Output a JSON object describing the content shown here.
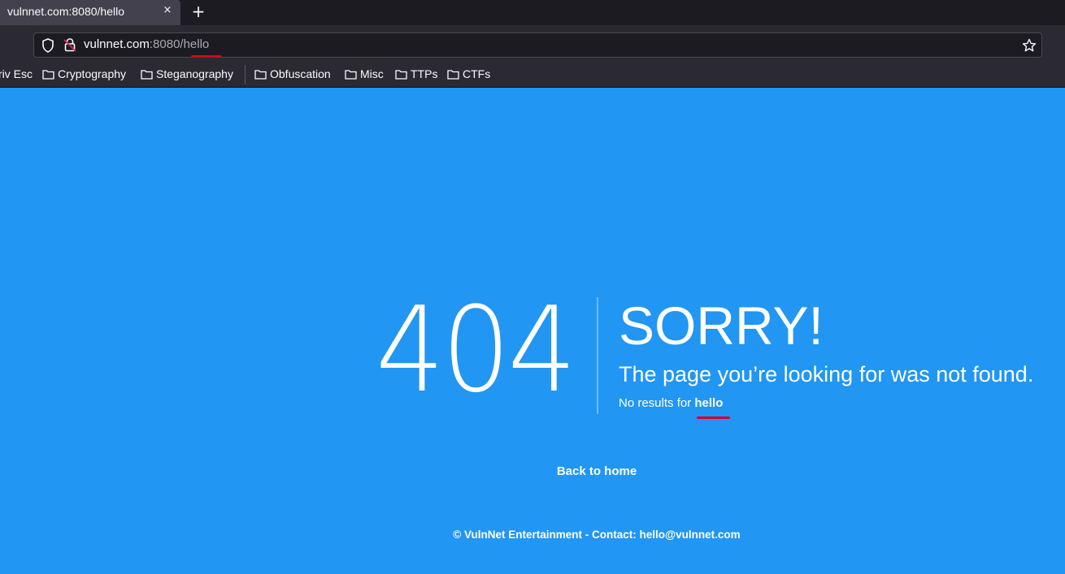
{
  "browser": {
    "tab": {
      "title": "vulnnet.com:8080/hello",
      "close_glyph": "×"
    },
    "new_tab_glyph": "+",
    "url": {
      "host": "vulnnet.com",
      "rest": ":8080/hello"
    },
    "bookmarks": [
      {
        "label": "riv Esc",
        "icon": "none"
      },
      {
        "label": "Cryptography",
        "icon": "folder-icon"
      },
      {
        "label": "Steganography",
        "icon": "folder-icon"
      },
      {
        "label": "Obfuscation",
        "icon": "folder-icon"
      },
      {
        "label": "Misc",
        "icon": "folder-icon"
      },
      {
        "label": "TTPs",
        "icon": "folder-icon"
      },
      {
        "label": "CTFs",
        "icon": "folder-icon"
      }
    ]
  },
  "page": {
    "code": "404",
    "heading": "SORRY!",
    "message": "The page you’re looking for was not found.",
    "no_results_prefix": "No results for",
    "search_term": "hello",
    "back_link": "Back to home",
    "footer": "© VulnNet Entertainment - Contact: hello@vulnnet.com",
    "background_color": "#2196f3",
    "annotation_color": "#d70022"
  }
}
